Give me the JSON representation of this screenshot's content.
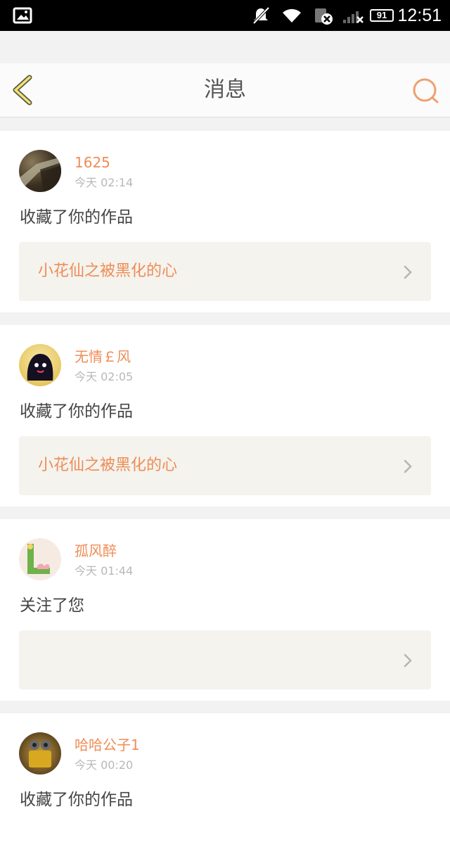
{
  "status_bar": {
    "time": "12:51",
    "battery": "91",
    "icons": [
      "image-icon",
      "mute-icon",
      "wifi-icon",
      "sim-error-icon",
      "signal-icon",
      "battery-icon"
    ]
  },
  "header": {
    "title": "消息",
    "back_icon": "chevron-left-icon",
    "search_icon": "search-icon",
    "accent": "#f0a070"
  },
  "messages": [
    {
      "user": "1625",
      "time": "今天 02:14",
      "action": "收藏了你的作品",
      "work_title": "小花仙之被黑化的心"
    },
    {
      "user": "无情￡风",
      "time": "今天 02:05",
      "action": "收藏了你的作品",
      "work_title": "小花仙之被黑化的心"
    },
    {
      "user": "孤风醉",
      "time": "今天 01:44",
      "action": "关注了您",
      "work_title": ""
    },
    {
      "user": "哈哈公子1",
      "time": "今天 00:20",
      "action": "收藏了你的作品",
      "work_title": ""
    }
  ],
  "colors": {
    "username": "#ef8c55",
    "timestamp": "#b8b8b8",
    "card_bg": "#f4f3ee"
  }
}
